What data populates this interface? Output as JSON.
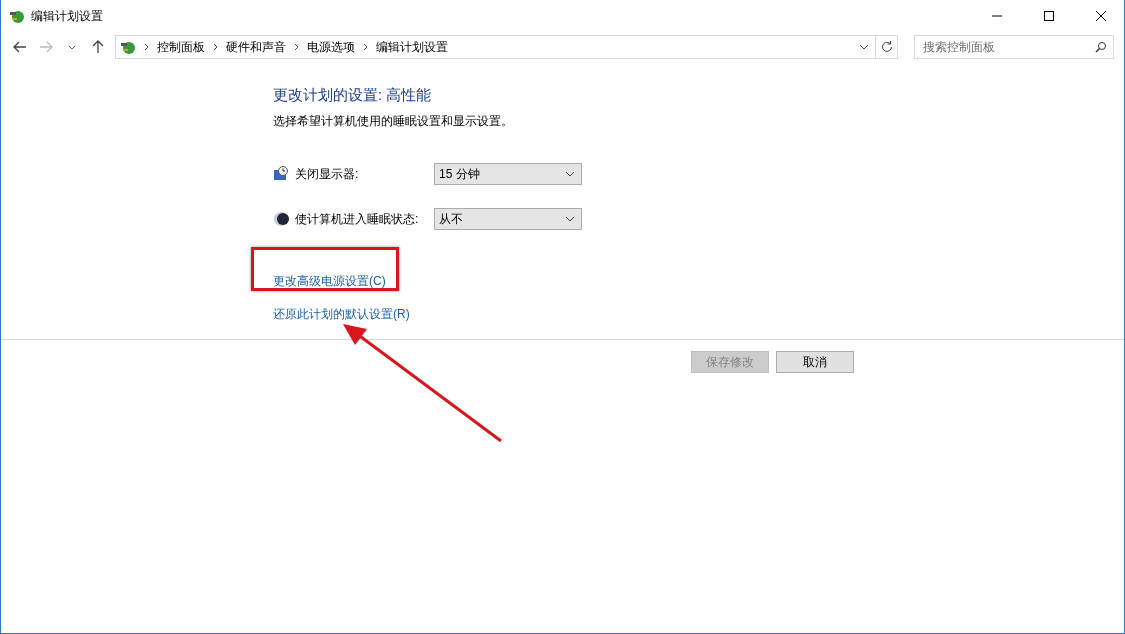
{
  "window": {
    "title": "编辑计划设置"
  },
  "address_bar": {
    "breadcrumbs": [
      "控制面板",
      "硬件和声音",
      "电源选项",
      "编辑计划设置"
    ]
  },
  "search": {
    "placeholder": "搜索控制面板"
  },
  "heading": "更改计划的设置: 高性能",
  "description": "选择希望计算机使用的睡眠设置和显示设置。",
  "settings": [
    {
      "kind": "display",
      "label": "关闭显示器:",
      "value": "15 分钟"
    },
    {
      "kind": "sleep",
      "label": "使计算机进入睡眠状态:",
      "value": "从不"
    }
  ],
  "links": [
    {
      "text": "更改高级电源设置(C)",
      "highlighted": true
    },
    {
      "text": "还原此计划的默认设置(R)",
      "highlighted": false
    }
  ],
  "buttons": [
    {
      "label": "保存修改",
      "disabled": true
    },
    {
      "label": "取消",
      "disabled": false
    }
  ],
  "callout_arrow": true
}
